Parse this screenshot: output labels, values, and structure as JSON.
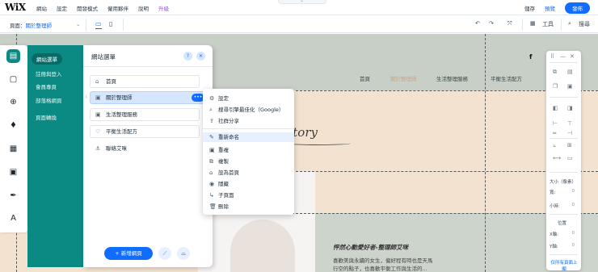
{
  "topbar": {
    "logo": "WiX",
    "menu": [
      "網站",
      "設定",
      "開發模式",
      "僱用夥伴",
      "說明",
      "升級"
    ],
    "save": "儲存",
    "preview": "預覽",
    "publish": "發佈"
  },
  "bar2": {
    "page_label": "頁面：",
    "page_name": "關於整理師",
    "tools_label": "工具",
    "search_label": "搜尋",
    "icons": {
      "undo": "↶",
      "redo": "↷",
      "zoom": "⤧",
      "tools": "▦",
      "search": "⌕",
      "desktop": "▭",
      "mobile": "▯"
    }
  },
  "site": {
    "nav": [
      "首頁",
      "關於整理師",
      "生活整理服務",
      "平衡生活配方"
    ],
    "story": "Story",
    "slogan": "怦然心動愛好者-整理師艾咪",
    "body_lines": [
      "喜歡美與永續的女生，偏好程有時也是天馬",
      "行空的點子，也喜歡平衡工作與生活的..."
    ],
    "social": "f"
  },
  "left_toolbar": {
    "icons": [
      "pages-icon",
      "background-icon",
      "add-icon",
      "theme-icon",
      "apps-icon",
      "media-icon",
      "pen-icon",
      "text-icon"
    ],
    "glyphs": [
      "▤",
      "▢",
      "⊕",
      "♦",
      "▦",
      "▣",
      "✒",
      "A"
    ]
  },
  "teal_panel": {
    "items": [
      "網站選單",
      "註冊與登入",
      "會員專頁",
      "部落格網頁",
      "頁面轉換"
    ]
  },
  "menu_panel": {
    "title": "網站選單",
    "help": "?",
    "close": "✕",
    "pages": [
      "首頁",
      "關於整理師",
      "生活整理服務",
      "平衡生活配方",
      "聯絡艾咪"
    ],
    "page_icons": [
      "⌂",
      "▣",
      "▣",
      "♡",
      "⚓"
    ],
    "dots": "•••",
    "add_page": "+ 新增網頁",
    "grip": "⁞"
  },
  "context_menu": {
    "items": [
      {
        "icon": "⚙",
        "label": "設定"
      },
      {
        "icon": "⌕",
        "label": "搜尋引擎最佳化（Google）"
      },
      {
        "icon": "⇪",
        "label": "社群分享"
      },
      {
        "icon": "✎",
        "label": "重新命名"
      },
      {
        "icon": "▣",
        "label": "重複"
      },
      {
        "icon": "⧉",
        "label": "複製"
      },
      {
        "icon": "⌂",
        "label": "設為首頁"
      },
      {
        "icon": "◉",
        "label": "隱藏"
      },
      {
        "icon": "↳",
        "label": "子頁面"
      },
      {
        "icon": "🗑",
        "label": "刪除"
      }
    ]
  },
  "right_panel": {
    "size_label": "大小（像素）",
    "width_label": "寬:",
    "height_label": "小時:",
    "width_val": "0",
    "height_val": "0",
    "position_label": "位置",
    "x_label": "X軸:",
    "y_label": "Y軸:",
    "x_val": "0",
    "y_val": "0",
    "link": [
      "仅所有頁面上",
      "顯"
    ]
  },
  "colors": {
    "accent": "#116dff",
    "teal": "#0a8a83",
    "upgrade": "#9a4fd8",
    "canvas_peach": "#f3e2d0",
    "canvas_green": "#c8cfc7"
  }
}
